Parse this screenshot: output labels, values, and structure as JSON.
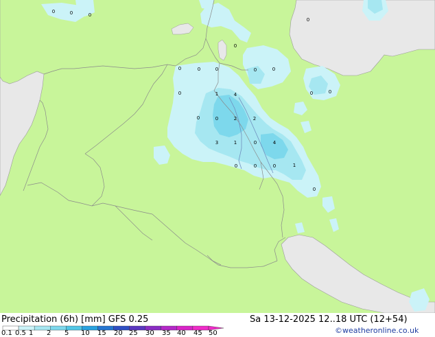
{
  "title": "Precipitation (6h) [mm] GFS 0.25",
  "valid_time": "Sa 13-12-2025 12..18 UTC (12+54)",
  "credit": "©weatheronline.co.uk",
  "legend": {
    "labels": [
      "0.1",
      "0.5",
      "1",
      "2",
      "5",
      "10",
      "15",
      "20",
      "25",
      "30",
      "35",
      "40",
      "45",
      "50"
    ],
    "colors": [
      "#ffffff",
      "#cbf3f8",
      "#a6e7f1",
      "#7dd8ec",
      "#52c7e6",
      "#2aa3e0",
      "#2676d2",
      "#2f4fc4",
      "#5a36c0",
      "#8a2cc4",
      "#b428c8",
      "#d924c8",
      "#ef2cc8"
    ]
  },
  "colors": {
    "land": "#c8f59a",
    "sea": "#e8e8e8",
    "precip_light": "#cbf3f8",
    "precip_mid": "#a6e7f1",
    "precip_heavy": "#7dd8ec"
  },
  "station_values": [
    {
      "v": "0"
    },
    {
      "v": "0"
    },
    {
      "v": "0"
    },
    {
      "v": "0"
    },
    {
      "v": "0"
    },
    {
      "v": "0"
    },
    {
      "v": "0"
    },
    {
      "v": "0"
    },
    {
      "v": "0"
    },
    {
      "v": "0"
    },
    {
      "v": "0"
    },
    {
      "v": "1"
    },
    {
      "v": "4"
    },
    {
      "v": "0"
    },
    {
      "v": "0"
    },
    {
      "v": "2"
    },
    {
      "v": "2"
    },
    {
      "v": "3"
    },
    {
      "v": "1"
    },
    {
      "v": "0"
    },
    {
      "v": "4"
    },
    {
      "v": "0"
    },
    {
      "v": "0"
    },
    {
      "v": "0"
    },
    {
      "v": "1"
    },
    {
      "v": "0"
    },
    {
      "v": "0"
    },
    {
      "v": "0"
    }
  ]
}
